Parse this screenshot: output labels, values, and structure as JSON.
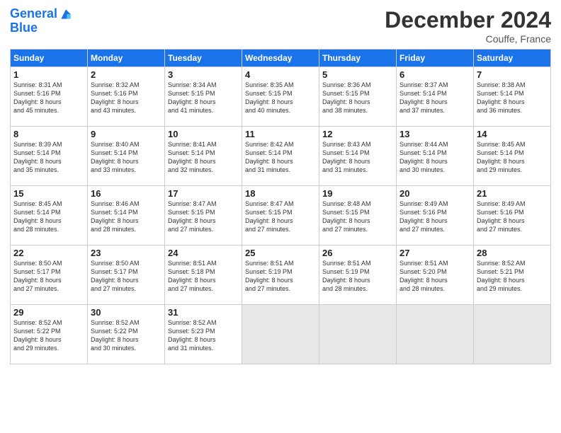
{
  "header": {
    "logo_line1": "General",
    "logo_line2": "Blue",
    "title": "December 2024",
    "location": "Couffe, France"
  },
  "days_of_week": [
    "Sunday",
    "Monday",
    "Tuesday",
    "Wednesday",
    "Thursday",
    "Friday",
    "Saturday"
  ],
  "weeks": [
    [
      {
        "day": "1",
        "info": "Sunrise: 8:31 AM\nSunset: 5:16 PM\nDaylight: 8 hours\nand 45 minutes."
      },
      {
        "day": "2",
        "info": "Sunrise: 8:32 AM\nSunset: 5:16 PM\nDaylight: 8 hours\nand 43 minutes."
      },
      {
        "day": "3",
        "info": "Sunrise: 8:34 AM\nSunset: 5:15 PM\nDaylight: 8 hours\nand 41 minutes."
      },
      {
        "day": "4",
        "info": "Sunrise: 8:35 AM\nSunset: 5:15 PM\nDaylight: 8 hours\nand 40 minutes."
      },
      {
        "day": "5",
        "info": "Sunrise: 8:36 AM\nSunset: 5:15 PM\nDaylight: 8 hours\nand 38 minutes."
      },
      {
        "day": "6",
        "info": "Sunrise: 8:37 AM\nSunset: 5:14 PM\nDaylight: 8 hours\nand 37 minutes."
      },
      {
        "day": "7",
        "info": "Sunrise: 8:38 AM\nSunset: 5:14 PM\nDaylight: 8 hours\nand 36 minutes."
      }
    ],
    [
      {
        "day": "8",
        "info": "Sunrise: 8:39 AM\nSunset: 5:14 PM\nDaylight: 8 hours\nand 35 minutes."
      },
      {
        "day": "9",
        "info": "Sunrise: 8:40 AM\nSunset: 5:14 PM\nDaylight: 8 hours\nand 33 minutes."
      },
      {
        "day": "10",
        "info": "Sunrise: 8:41 AM\nSunset: 5:14 PM\nDaylight: 8 hours\nand 32 minutes."
      },
      {
        "day": "11",
        "info": "Sunrise: 8:42 AM\nSunset: 5:14 PM\nDaylight: 8 hours\nand 31 minutes."
      },
      {
        "day": "12",
        "info": "Sunrise: 8:43 AM\nSunset: 5:14 PM\nDaylight: 8 hours\nand 31 minutes."
      },
      {
        "day": "13",
        "info": "Sunrise: 8:44 AM\nSunset: 5:14 PM\nDaylight: 8 hours\nand 30 minutes."
      },
      {
        "day": "14",
        "info": "Sunrise: 8:45 AM\nSunset: 5:14 PM\nDaylight: 8 hours\nand 29 minutes."
      }
    ],
    [
      {
        "day": "15",
        "info": "Sunrise: 8:45 AM\nSunset: 5:14 PM\nDaylight: 8 hours\nand 28 minutes."
      },
      {
        "day": "16",
        "info": "Sunrise: 8:46 AM\nSunset: 5:14 PM\nDaylight: 8 hours\nand 28 minutes."
      },
      {
        "day": "17",
        "info": "Sunrise: 8:47 AM\nSunset: 5:15 PM\nDaylight: 8 hours\nand 27 minutes."
      },
      {
        "day": "18",
        "info": "Sunrise: 8:47 AM\nSunset: 5:15 PM\nDaylight: 8 hours\nand 27 minutes."
      },
      {
        "day": "19",
        "info": "Sunrise: 8:48 AM\nSunset: 5:15 PM\nDaylight: 8 hours\nand 27 minutes."
      },
      {
        "day": "20",
        "info": "Sunrise: 8:49 AM\nSunset: 5:16 PM\nDaylight: 8 hours\nand 27 minutes."
      },
      {
        "day": "21",
        "info": "Sunrise: 8:49 AM\nSunset: 5:16 PM\nDaylight: 8 hours\nand 27 minutes."
      }
    ],
    [
      {
        "day": "22",
        "info": "Sunrise: 8:50 AM\nSunset: 5:17 PM\nDaylight: 8 hours\nand 27 minutes."
      },
      {
        "day": "23",
        "info": "Sunrise: 8:50 AM\nSunset: 5:17 PM\nDaylight: 8 hours\nand 27 minutes."
      },
      {
        "day": "24",
        "info": "Sunrise: 8:51 AM\nSunset: 5:18 PM\nDaylight: 8 hours\nand 27 minutes."
      },
      {
        "day": "25",
        "info": "Sunrise: 8:51 AM\nSunset: 5:19 PM\nDaylight: 8 hours\nand 27 minutes."
      },
      {
        "day": "26",
        "info": "Sunrise: 8:51 AM\nSunset: 5:19 PM\nDaylight: 8 hours\nand 28 minutes."
      },
      {
        "day": "27",
        "info": "Sunrise: 8:51 AM\nSunset: 5:20 PM\nDaylight: 8 hours\nand 28 minutes."
      },
      {
        "day": "28",
        "info": "Sunrise: 8:52 AM\nSunset: 5:21 PM\nDaylight: 8 hours\nand 29 minutes."
      }
    ],
    [
      {
        "day": "29",
        "info": "Sunrise: 8:52 AM\nSunset: 5:22 PM\nDaylight: 8 hours\nand 29 minutes."
      },
      {
        "day": "30",
        "info": "Sunrise: 8:52 AM\nSunset: 5:22 PM\nDaylight: 8 hours\nand 30 minutes."
      },
      {
        "day": "31",
        "info": "Sunrise: 8:52 AM\nSunset: 5:23 PM\nDaylight: 8 hours\nand 31 minutes."
      },
      null,
      null,
      null,
      null
    ]
  ]
}
